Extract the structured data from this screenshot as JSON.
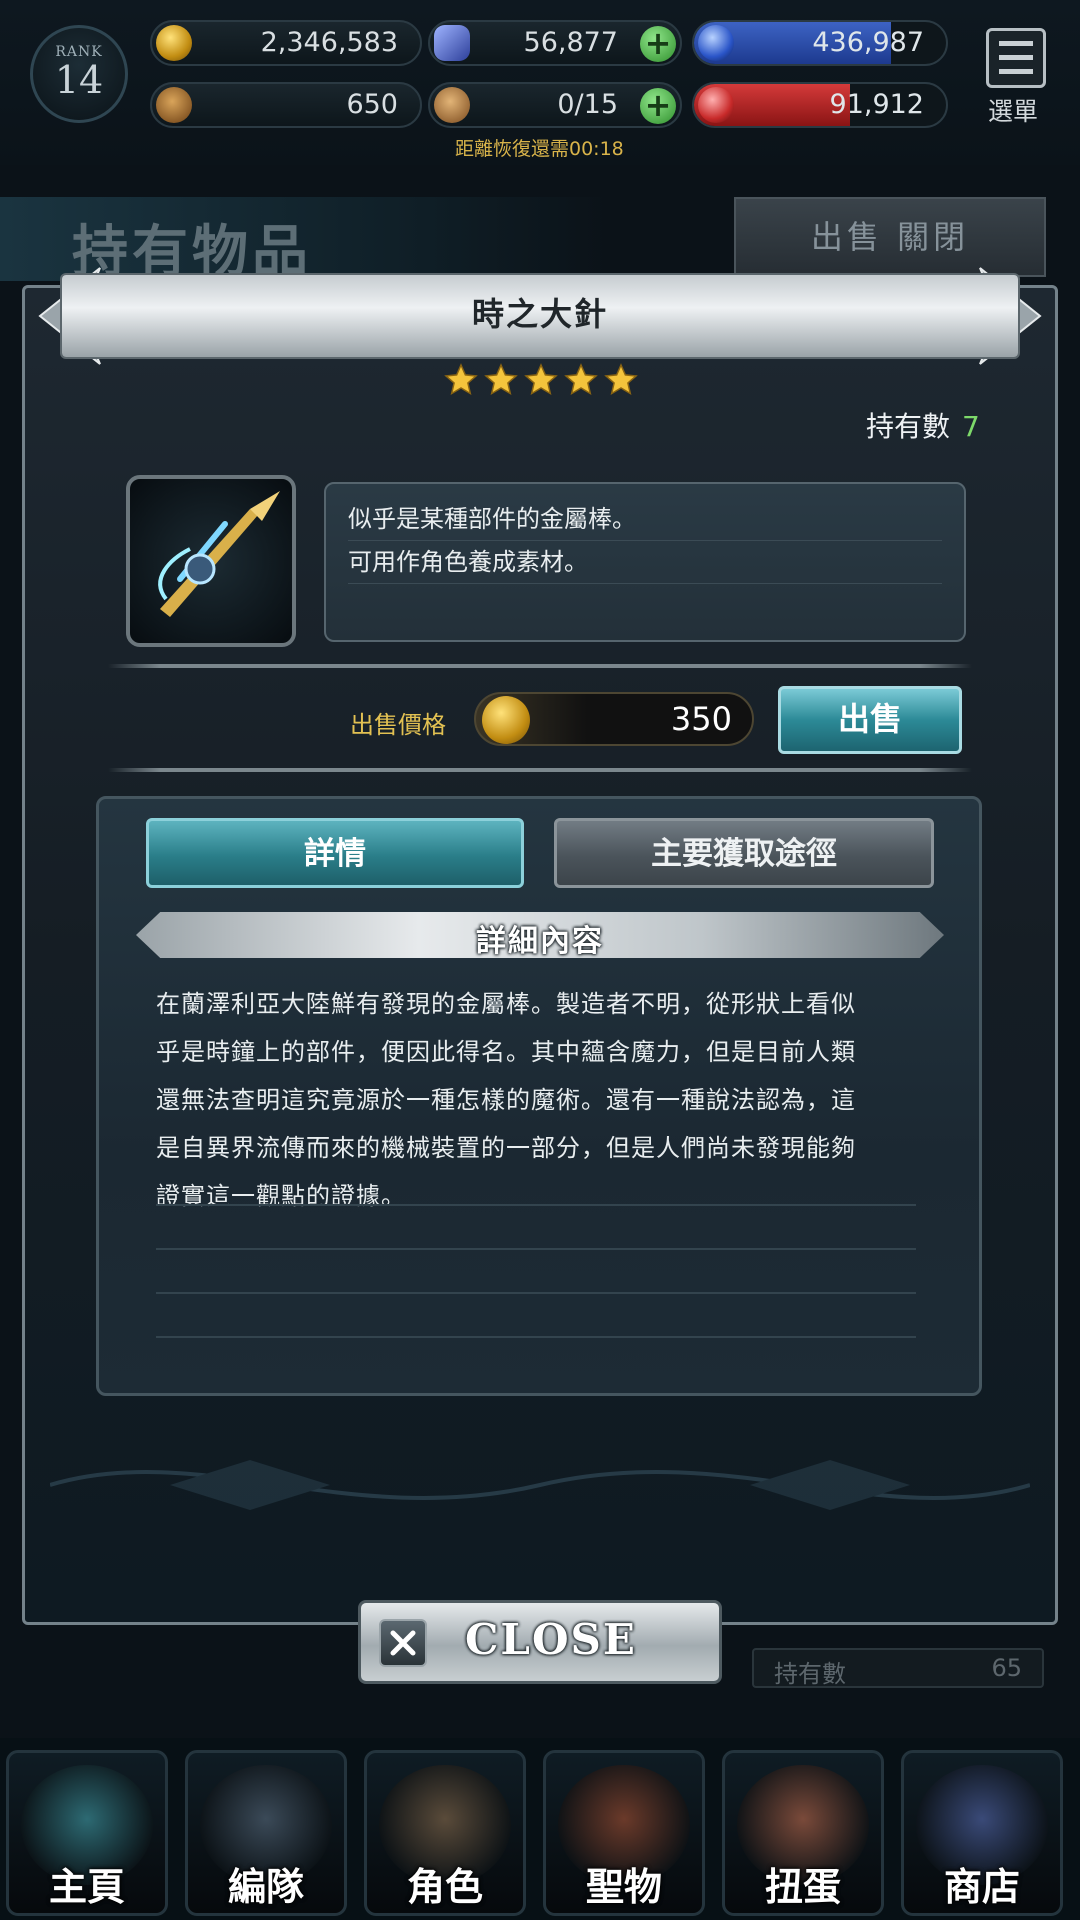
{
  "status": {
    "rank_label": "RANK",
    "rank_value": "14",
    "gold": "2,346,583",
    "crystals": "56,877",
    "blue_orb": "436,987",
    "medals": "650",
    "stamina": "0/15",
    "red_orb": "91,912",
    "recovery": "距離恢復還需00:18",
    "menu_label": "選單",
    "blue_fill_pct": 78,
    "red_fill_pct": 62
  },
  "background": {
    "page_title": "持有物品",
    "sell_close": "出售 關閉",
    "owned_label": "持有數",
    "owned_value": "65"
  },
  "dialog": {
    "item_name": "時之大針",
    "rarity_stars": 5,
    "owned_label": "持有數",
    "owned_value": "7",
    "description": [
      "似乎是某種部件的金屬棒。",
      "可用作角色養成素材。"
    ],
    "price_label": "出售價格",
    "price_value": "350",
    "sell_button": "出售",
    "tabs": [
      {
        "label": "詳情",
        "active": true
      },
      {
        "label": "主要獲取途徑",
        "active": false
      }
    ],
    "detail_heading": "詳細內容",
    "detail_lines": [
      "在蘭澤利亞大陸鮮有發現的金屬棒。製造者不明，從形狀上看似",
      "乎是時鐘上的部件，便因此得名。其中蘊含魔力，但是目前人類",
      "還無法查明這究竟源於一種怎樣的魔術。還有一種說法認為，這",
      "是自異界流傳而來的機械裝置的一部分，但是人們尚未發現能夠",
      "證實這一觀點的證據。"
    ],
    "close_label": "CLOSE"
  },
  "nav": [
    {
      "label": "主頁",
      "icon": "home-icon",
      "color": "#2d6a73"
    },
    {
      "label": "編隊",
      "icon": "party-icon",
      "color": "#3b4a58"
    },
    {
      "label": "角色",
      "icon": "character-icon",
      "color": "#5a4b3a"
    },
    {
      "label": "聖物",
      "icon": "relic-icon",
      "color": "#6b3a2a"
    },
    {
      "label": "扭蛋",
      "icon": "gacha-icon",
      "color": "#7a4a3a"
    },
    {
      "label": "商店",
      "icon": "shop-icon",
      "color": "#3a4a78"
    }
  ],
  "colors": {
    "accent_teal": "#2c8a97",
    "gold_text": "#e2c152",
    "owned_green": "#7dd96a"
  }
}
